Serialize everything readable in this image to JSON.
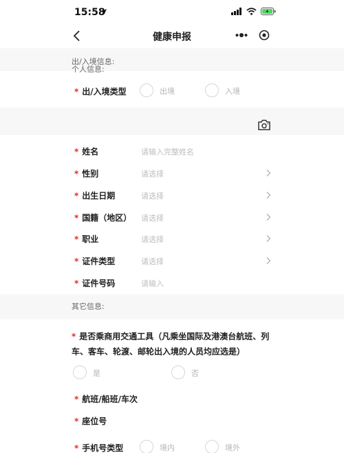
{
  "status_bar": {
    "time": "15:58"
  },
  "nav": {
    "title": "健康申报"
  },
  "sections": {
    "travel_info": "出/入境信息:",
    "personal_info": "个人信息:",
    "other_info": "其它信息:"
  },
  "travel": {
    "type_label": "出/入境类型",
    "options": [
      "出境",
      "入境"
    ]
  },
  "personal": {
    "name_label": "姓名",
    "name_placeholder": "请输入完整姓名",
    "gender_label": "性别",
    "birth_label": "出生日期",
    "nationality_label": "国籍（地区）",
    "job_label": "职业",
    "id_type_label": "证件类型",
    "id_number_label": "证件号码",
    "select_placeholder": "请选择",
    "input_placeholder": "请输入"
  },
  "other": {
    "transport_question": "是否乘商用交通工具（凡乘坐国际及港澳台航班、列车、客车、轮渡、邮轮出入境的人员均应选是）",
    "yes_label": "是",
    "no_label": "否",
    "flight_label": "航班/船班/车次",
    "seat_label": "座位号",
    "phone_type_label": "手机号类型",
    "phone_options": [
      "境内",
      "境外"
    ]
  },
  "required_mark": "*",
  "colors": {
    "required": "#e02e24",
    "placeholder": "#bdbdbd",
    "section_bg": "#f7f7f7"
  },
  "icons": {
    "back": "chevron-left-icon",
    "more": "more-dots-icon",
    "target": "target-icon",
    "camera": "camera-icon",
    "chevron": "chevron-right-icon"
  }
}
